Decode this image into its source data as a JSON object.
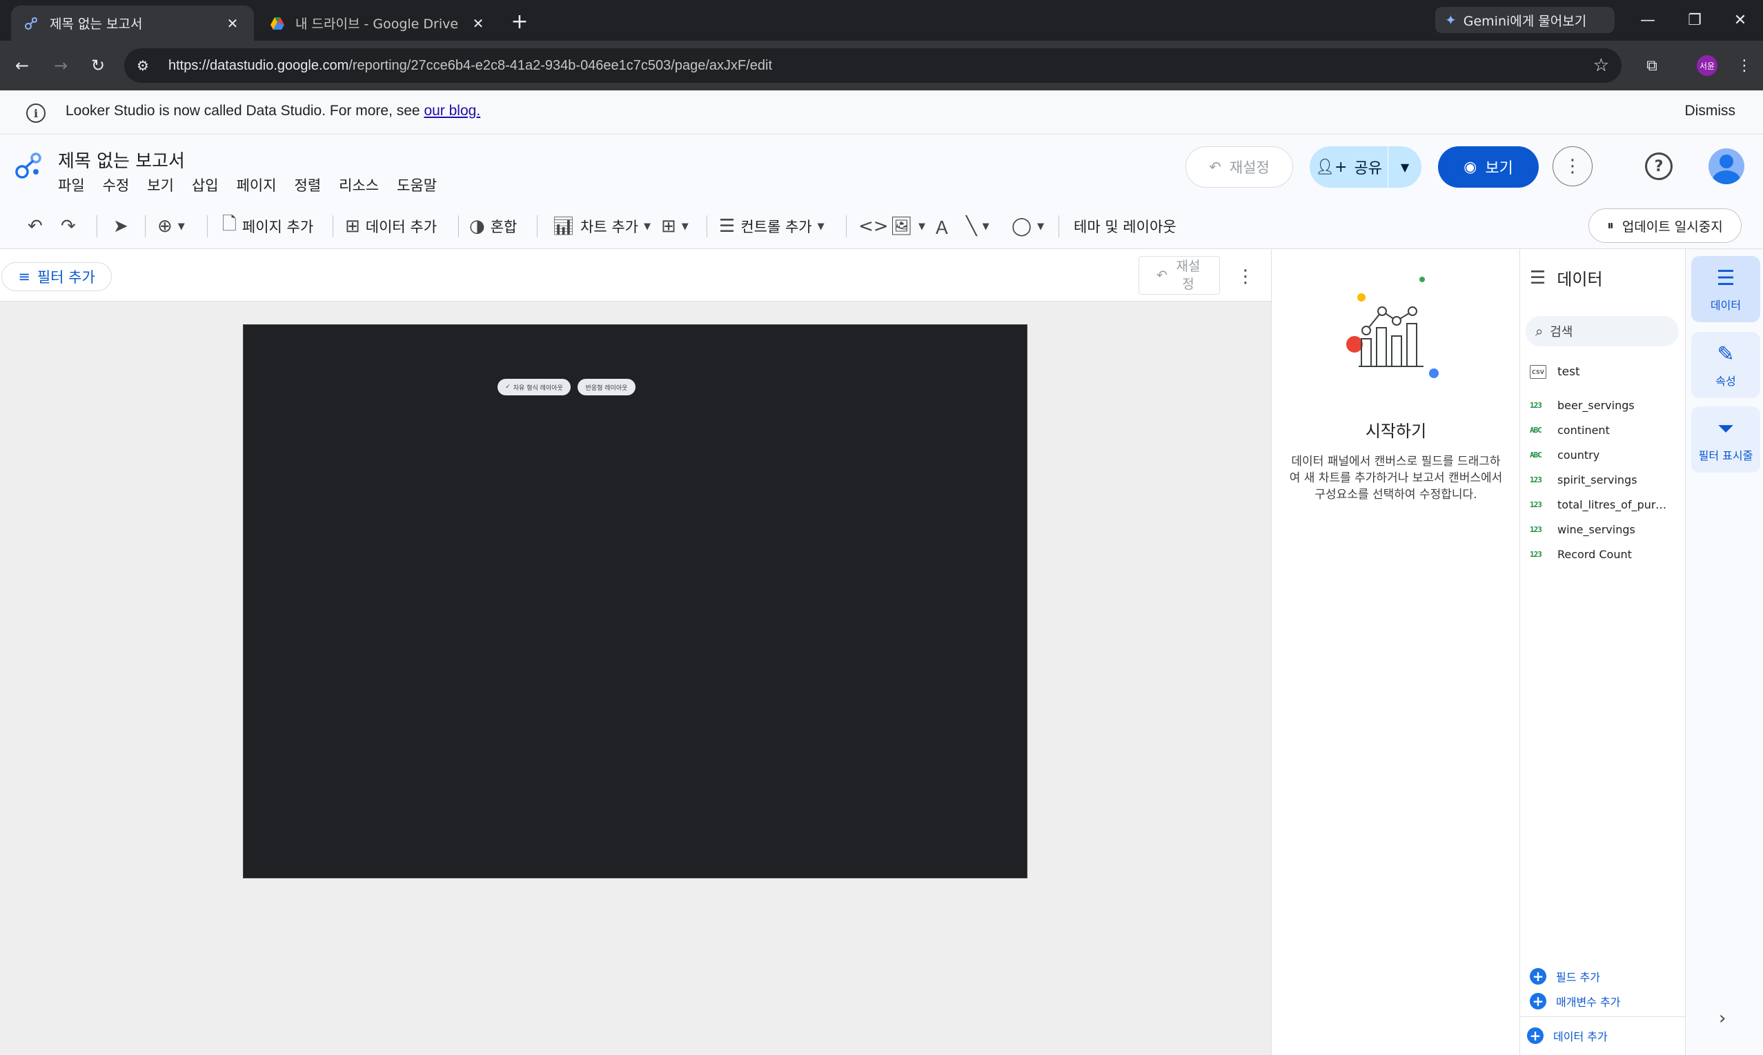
{
  "browser": {
    "tabs": [
      {
        "title": "제목 없는 보고서",
        "active": true
      },
      {
        "title": "내 드라이브 - Google Drive",
        "active": false
      }
    ],
    "gemini_label": "Gemini에게 물어보기",
    "url_domain": "https://datastudio.google.com",
    "url_path": "/reporting/27cce6b4-e2c8-41a2-934b-046ee1c7c503/page/axJxF/edit",
    "profile_initials": "서윤"
  },
  "banner": {
    "message": "Looker Studio is now called Data Studio. For more, see ",
    "link": "our blog.",
    "dismiss": "Dismiss"
  },
  "header": {
    "title": "제목 없는 보고서",
    "menus": [
      "파일",
      "수정",
      "보기",
      "삽입",
      "페이지",
      "정렬",
      "리소스",
      "도움말"
    ],
    "reset_label": "재설정",
    "share_label": "공유",
    "view_label": "보기"
  },
  "toolbar": {
    "add_page": "페이지 추가",
    "add_data": "데이터 추가",
    "blend": "혼합",
    "add_chart": "차트 추가",
    "add_control": "컨트롤 추가",
    "theme_layout": "테마 및 레이아웃",
    "pause_updates": "업데이트 일시중지"
  },
  "canvas": {
    "add_filter": "필터 추가",
    "reset_line1": "재설",
    "reset_line2": "정",
    "layout_freeform": "자유 형식 레이아웃",
    "layout_responsive": "반응형 레이아웃"
  },
  "start_panel": {
    "title": "시작하기",
    "description": "데이터 패널에서 캔버스로 필드를 드래그하여 새 차트를 추가하거나 보고서 캔버스에서 구성요소를 선택하여 수정합니다."
  },
  "data_panel": {
    "title": "데이터",
    "search_placeholder": "검색",
    "source_name": "test",
    "source_type": "CSV",
    "fields": [
      {
        "type": "123",
        "name": "beer_servings"
      },
      {
        "type": "ABC",
        "name": "continent"
      },
      {
        "type": "ABC",
        "name": "country"
      },
      {
        "type": "123",
        "name": "spirit_servings"
      },
      {
        "type": "123",
        "name": "total_litres_of_pure_..."
      },
      {
        "type": "123",
        "name": "wine_servings"
      },
      {
        "type": "123",
        "name": "Record Count"
      }
    ],
    "add_field": "필드 추가",
    "add_parameter": "매개변수 추가",
    "add_data": "데이터 추가"
  },
  "rail": {
    "data": "데이터",
    "properties": "속성",
    "filter_display": "필터 표시줄"
  }
}
